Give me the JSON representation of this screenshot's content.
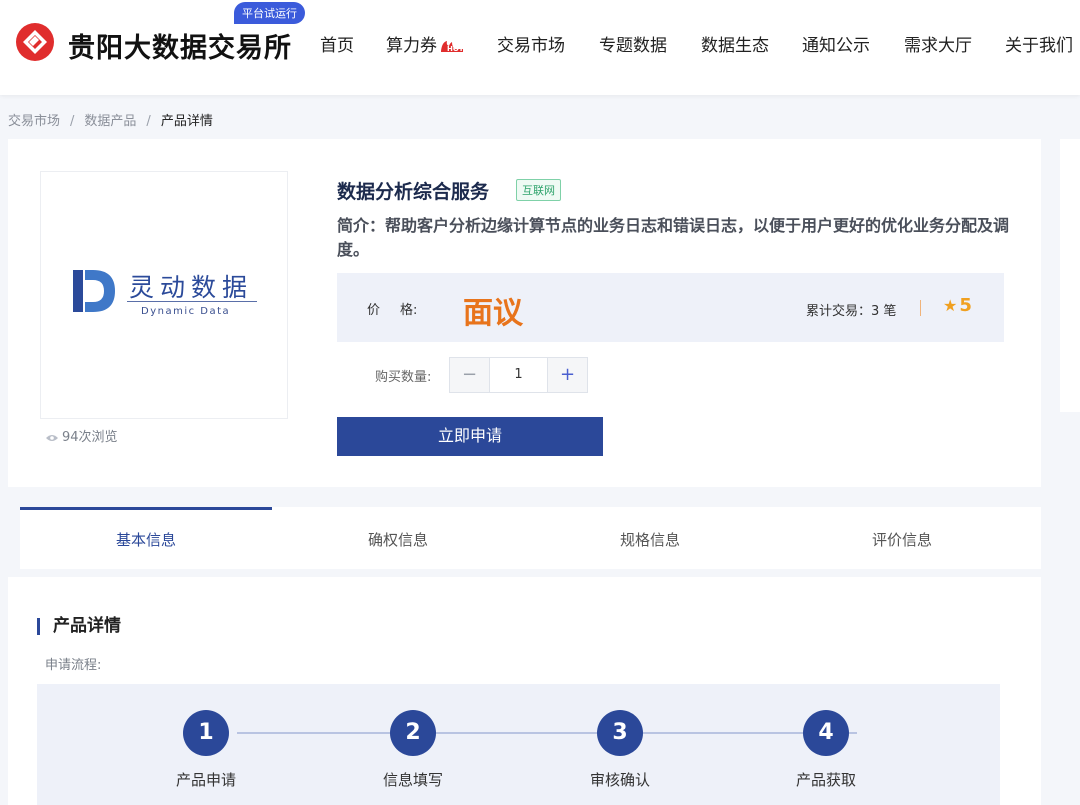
{
  "header": {
    "logo_text": "贵阳大数据交易所",
    "trial_badge": "平台试运行",
    "nav": [
      {
        "label": "首页"
      },
      {
        "label": "算力券"
      },
      {
        "label": "交易市场"
      },
      {
        "label": "专题数据"
      },
      {
        "label": "数据生态"
      },
      {
        "label": "通知公示"
      },
      {
        "label": "需求大厅"
      },
      {
        "label": "关于我们"
      }
    ],
    "hot_badge": "HOT"
  },
  "breadcrumb": {
    "items": [
      "交易市场",
      "数据产品"
    ],
    "separator": "/",
    "current": "产品详情"
  },
  "product": {
    "logo_cn": "灵动数据",
    "logo_en": "Dynamic Data",
    "views": "94次浏览",
    "title": "数据分析综合服务",
    "tag": "互联网",
    "intro": "简介：帮助客户分析边缘计算节点的业务日志和错误日志，以便于用户更好的优化业务分配及调度。",
    "price_label_a": "价",
    "price_label_b": "格:",
    "price_value": "面议",
    "trades_text": "累计交易：3 笔",
    "rating": "5",
    "qty_label": "购买数量:",
    "qty_value": "1",
    "apply_label": "立即申请"
  },
  "tabs": [
    {
      "label": "基本信息",
      "active": true
    },
    {
      "label": "确权信息",
      "active": false
    },
    {
      "label": "规格信息",
      "active": false
    },
    {
      "label": "评价信息",
      "active": false
    }
  ],
  "detail": {
    "title": "产品详情",
    "flow_label": "申请流程:",
    "steps": [
      {
        "num": "1",
        "label": "产品申请"
      },
      {
        "num": "2",
        "label": "信息填写"
      },
      {
        "num": "3",
        "label": "审核确认"
      },
      {
        "num": "4",
        "label": "产品获取"
      }
    ]
  },
  "colors": {
    "brand_blue": "#2b4899",
    "price_orange": "#e8741c",
    "logo_red": "#e02d2d",
    "star": "#f0a020"
  }
}
